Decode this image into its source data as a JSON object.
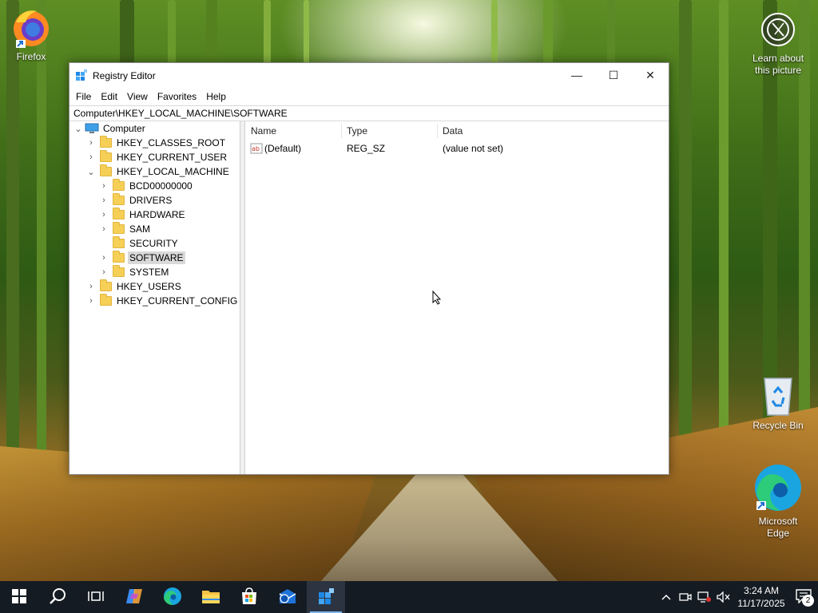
{
  "desktop": {
    "icons": [
      {
        "label": "Firefox",
        "icon": "firefox-icon"
      },
      {
        "label": "Learn about this picture",
        "icon": "camera-lens-icon"
      },
      {
        "label": "Recycle Bin",
        "icon": "recycle-bin-icon"
      },
      {
        "label": "Microsoft Edge",
        "icon": "edge-icon"
      }
    ]
  },
  "window": {
    "title": "Registry Editor",
    "controls": {
      "minimize": "—",
      "maximize": "☐",
      "close": "✕"
    },
    "menu": [
      "File",
      "Edit",
      "View",
      "Favorites",
      "Help"
    ],
    "address": "Computer\\HKEY_LOCAL_MACHINE\\SOFTWARE",
    "tree": {
      "root": "Computer",
      "hives": [
        "HKEY_CLASSES_ROOT",
        "HKEY_CURRENT_USER",
        "HKEY_LOCAL_MACHINE",
        "HKEY_USERS",
        "HKEY_CURRENT_CONFIG"
      ],
      "hklm_children": [
        "BCD00000000",
        "DRIVERS",
        "HARDWARE",
        "SAM",
        "SECURITY",
        "SOFTWARE",
        "SYSTEM"
      ],
      "selected": "SOFTWARE"
    },
    "list": {
      "columns": [
        "Name",
        "Type",
        "Data"
      ],
      "rows": [
        {
          "name": "(Default)",
          "type": "REG_SZ",
          "data": "(value not set)"
        }
      ]
    }
  },
  "taskbar": {
    "apps": [
      "start-icon",
      "search-icon",
      "task-view-icon",
      "copilot-icon",
      "edge-icon",
      "file-explorer-icon",
      "microsoft-store-icon",
      "outlook-icon",
      "registry-editor-icon"
    ],
    "active_app": "registry-editor-icon",
    "tray": [
      "chevron-up-icon",
      "meet-now-icon",
      "network-icon",
      "volume-muted-icon"
    ],
    "time": "3:24 AM",
    "date": "11/17/2025",
    "notification_count": "2"
  },
  "colors": {
    "taskbar": "#151b22",
    "selection": "#d9d9d9",
    "folder": "#f6cf57",
    "active_indicator": "#7ab4ee"
  }
}
